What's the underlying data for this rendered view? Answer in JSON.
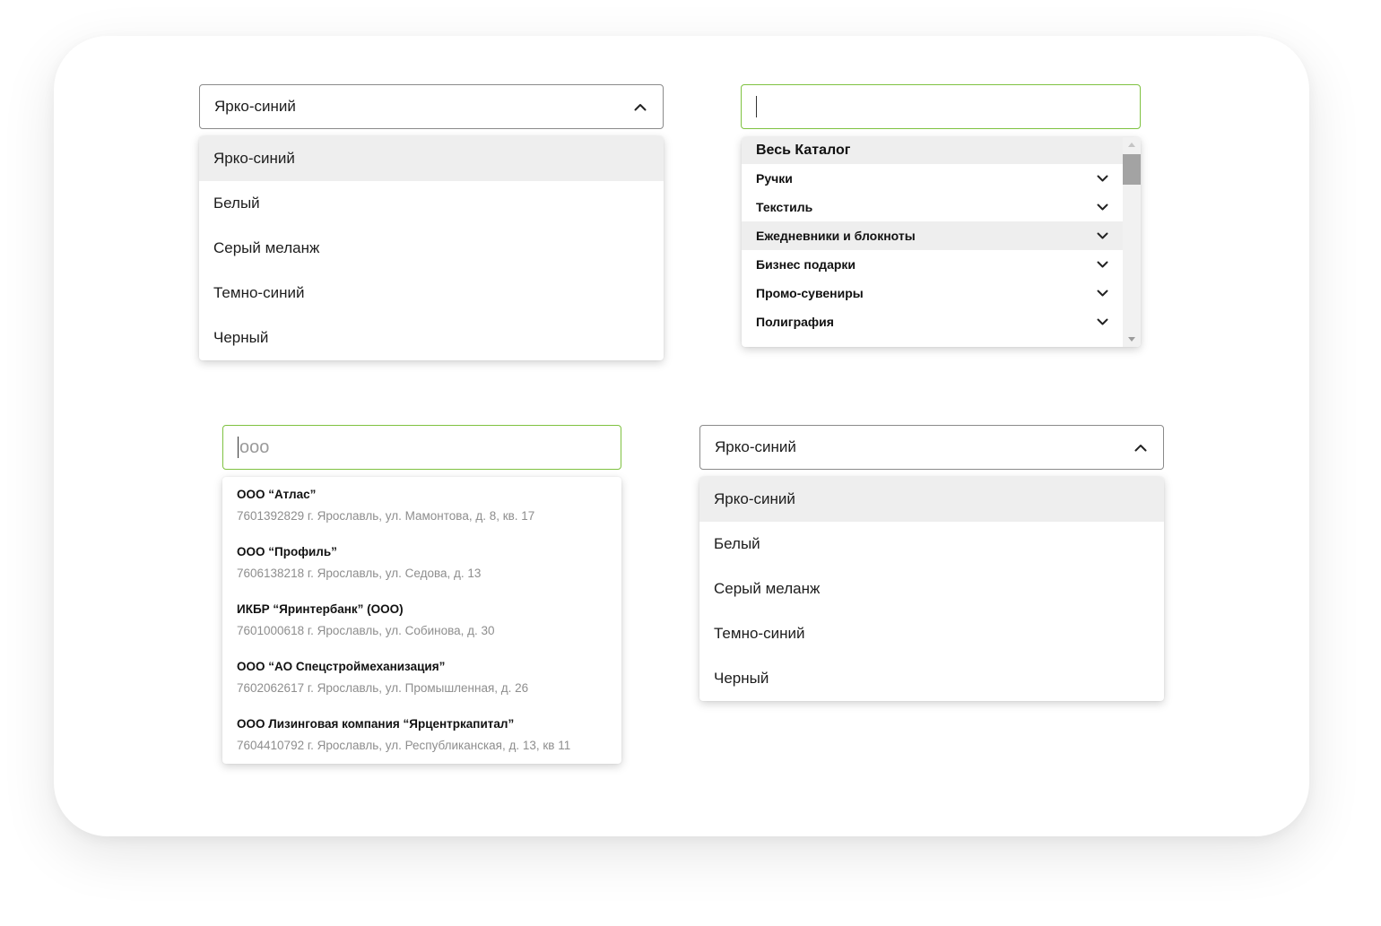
{
  "select1": {
    "value": "Ярко-синий",
    "options": [
      "Ярко-синий",
      "Белый",
      "Серый меланж",
      "Темно-синий",
      "Черный"
    ],
    "selected_index": 0
  },
  "catalog_search": {
    "value": "",
    "catalog": {
      "header": "Весь Каталог",
      "items": [
        "Ручки",
        "Текстиль",
        "Ежедневники и блокноты",
        "Бизнес подарки",
        "Промо-сувениры",
        "Полиграфия"
      ],
      "highlighted_index": 2
    }
  },
  "company_search": {
    "value": "ооо",
    "results": [
      {
        "name": "ООО “Атлас”",
        "details": "7601392829 г. Ярославль, ул. Мамонтова, д. 8, кв. 17"
      },
      {
        "name": "ООО “Профиль”",
        "details": "7606138218 г. Ярославль, ул. Седова, д. 13"
      },
      {
        "name": "ИКБР “Яринтербанк” (ООО)",
        "details": "7601000618 г. Ярославль, ул. Собинова, д. 30"
      },
      {
        "name": "ООО “АО Спецстроймеханизация”",
        "details": "7602062617 г. Ярославль, ул. Промышленная, д. 26"
      },
      {
        "name": "ООО Лизинговая компания “Ярцентркапитал”",
        "details": "7604410792 г. Ярославль, ул. Республиканская, д. 13, кв 11"
      }
    ]
  },
  "select2": {
    "value": "Ярко-синий",
    "options": [
      "Ярко-синий",
      "Белый",
      "Серый меланж",
      "Темно-синий",
      "Черный"
    ],
    "selected_index": 0
  },
  "colors": {
    "focus_border": "#7fc241",
    "highlight_bg": "#eeeeee",
    "border": "#8a8a8a",
    "muted_text": "#8e8e8e"
  },
  "icons": {
    "select_open": "chevron-up-icon",
    "category_expand": "chevron-down-icon",
    "scroll_up": "scroll-up-arrow-icon",
    "scroll_down": "scroll-down-arrow-icon"
  }
}
